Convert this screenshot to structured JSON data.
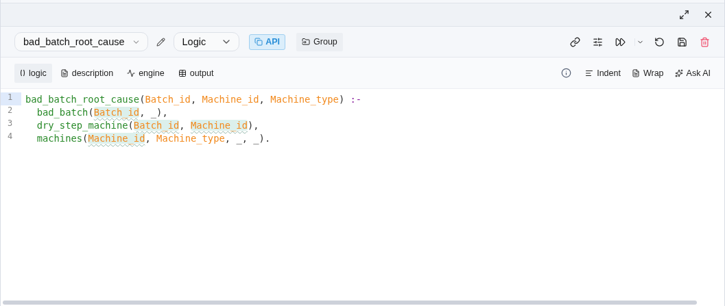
{
  "header": {
    "actions": [
      {
        "kind": "expand"
      },
      {
        "kind": "close"
      }
    ]
  },
  "toolbar": {
    "name_select": {
      "value": "bad_batch_root_cause"
    },
    "type_select": {
      "value": "Logic"
    },
    "api_button": {
      "label": "API",
      "selected": true
    },
    "group_button": {
      "label": "Group"
    },
    "actions": [
      {
        "kind": "link"
      },
      {
        "kind": "sliders"
      },
      {
        "kind": "run"
      },
      {
        "kind": "caret"
      },
      {
        "kind": "undo"
      },
      {
        "kind": "save"
      },
      {
        "kind": "delete"
      }
    ]
  },
  "tabs": [
    {
      "label": "logic",
      "selected": true
    },
    {
      "label": "description",
      "selected": false
    },
    {
      "label": "engine",
      "selected": false
    },
    {
      "label": "output",
      "selected": false
    }
  ],
  "editor_actions": [
    {
      "kind": "info"
    },
    {
      "kind": "indent",
      "label": "Indent"
    },
    {
      "kind": "wrap",
      "label": "Wrap"
    },
    {
      "kind": "ai",
      "label": "Ask AI"
    }
  ],
  "editor": {
    "lines": [
      {
        "number": "1",
        "selected": true,
        "tokens": [
          {
            "kind": "fn",
            "text": "bad_batch_root_cause"
          },
          {
            "kind": "punct",
            "text": "("
          },
          {
            "kind": "var",
            "text": "Batch_id",
            "highlighted": false
          },
          {
            "kind": "punct",
            "text": ", "
          },
          {
            "kind": "var",
            "text": "Machine_id",
            "highlighted": false
          },
          {
            "kind": "punct",
            "text": ", "
          },
          {
            "kind": "var",
            "text": "Machine_type",
            "highlighted": false
          },
          {
            "kind": "punct",
            "text": ") "
          },
          {
            "kind": "op",
            "text": ":-"
          }
        ]
      },
      {
        "number": "2",
        "selected": false,
        "tokens": [
          {
            "kind": "fn",
            "text": "bad_batch"
          },
          {
            "kind": "punct",
            "text": "("
          },
          {
            "kind": "var",
            "text": "Batch_id",
            "highlighted": true
          },
          {
            "kind": "punct",
            "text": ", _),"
          }
        ]
      },
      {
        "number": "3",
        "selected": false,
        "tokens": [
          {
            "kind": "fn",
            "text": "dry_step_machine"
          },
          {
            "kind": "punct",
            "text": "("
          },
          {
            "kind": "var",
            "text": "Batch_id",
            "highlighted": true
          },
          {
            "kind": "punct",
            "text": ", "
          },
          {
            "kind": "var",
            "text": "Machine_id",
            "highlighted": true
          },
          {
            "kind": "punct",
            "text": "),"
          }
        ]
      },
      {
        "number": "4",
        "selected": false,
        "tokens": [
          {
            "kind": "fn",
            "text": "machines"
          },
          {
            "kind": "punct",
            "text": "("
          },
          {
            "kind": "var",
            "text": "Machine_id",
            "highlighted": true
          },
          {
            "kind": "punct",
            "text": ", "
          },
          {
            "kind": "var",
            "text": "Machine_type",
            "highlighted": false
          },
          {
            "kind": "punct",
            "text": ", _, _)."
          }
        ]
      }
    ]
  }
}
